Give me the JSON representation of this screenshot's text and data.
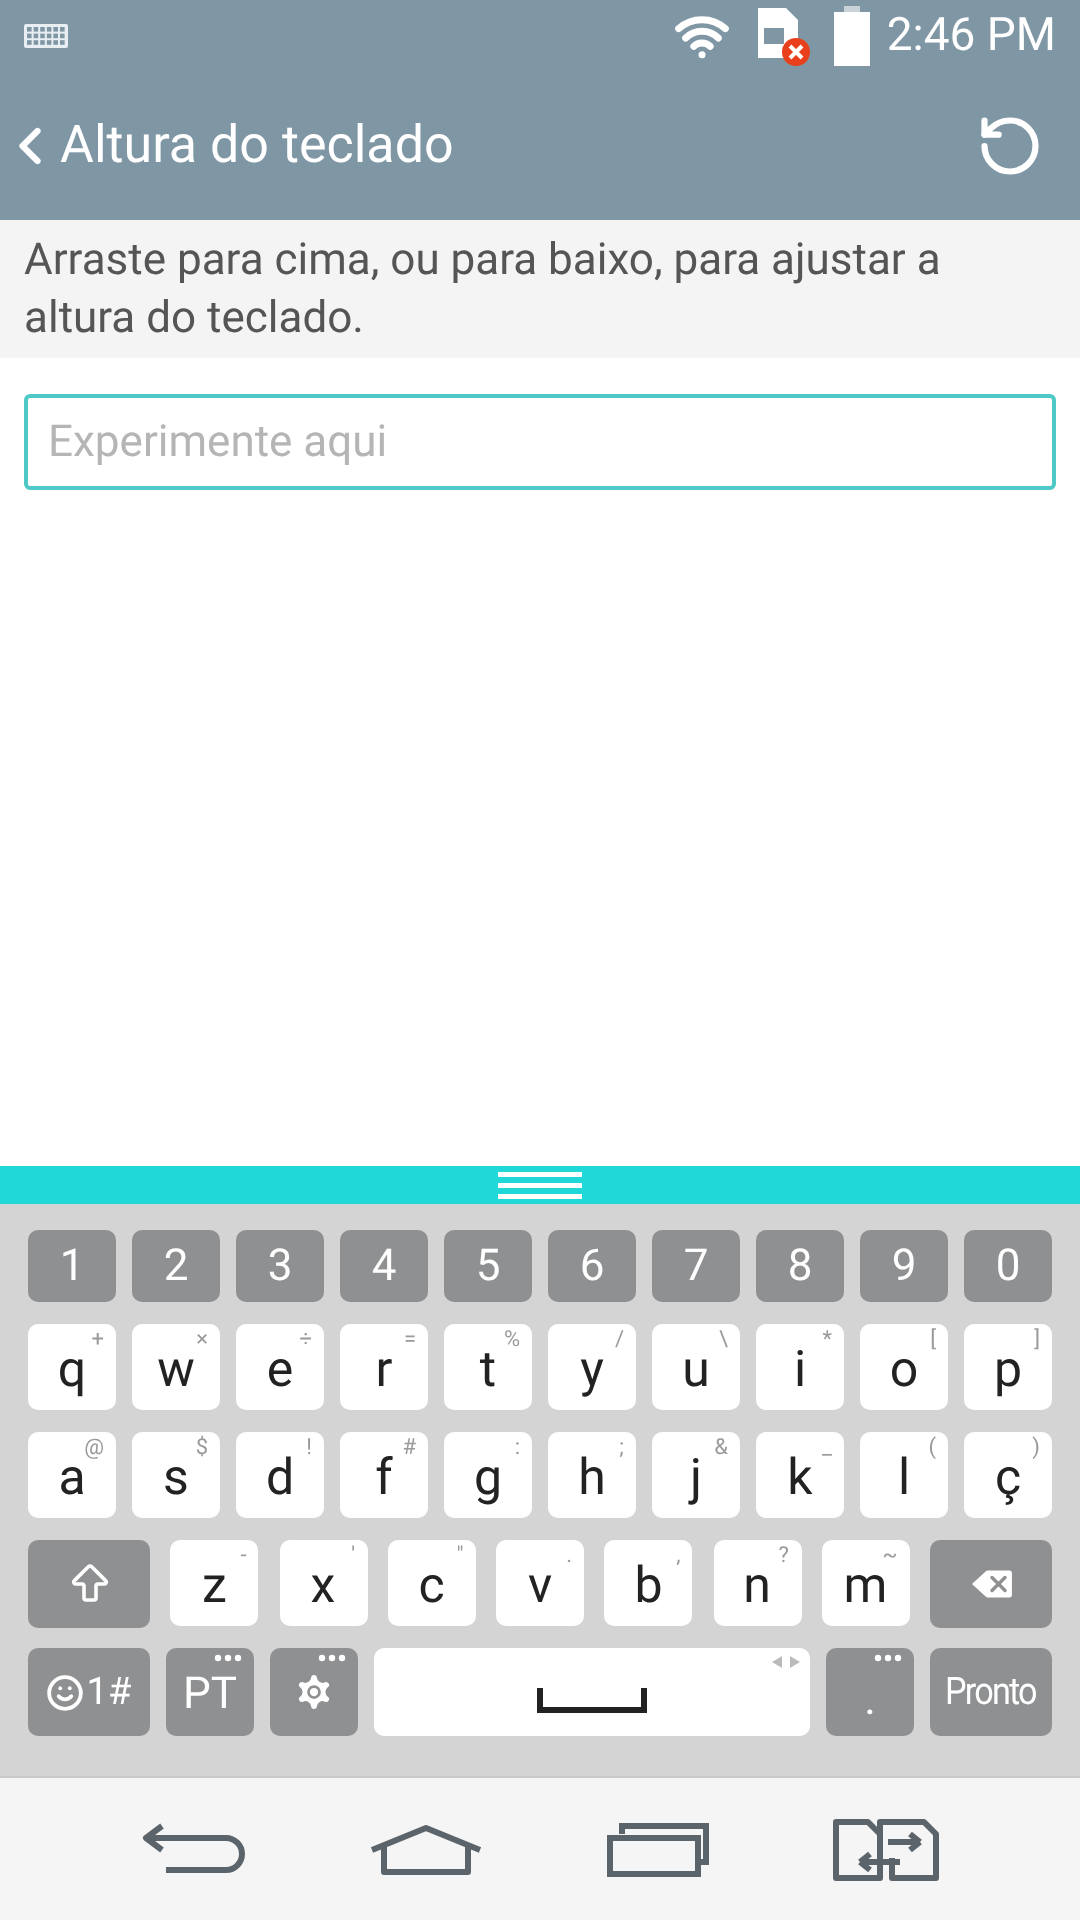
{
  "status_bar": {
    "time": "2:46 PM"
  },
  "app_bar": {
    "title": "Altura do teclado"
  },
  "description": "Arraste para cima, ou para baixo, para ajustar a altura do teclado.",
  "input": {
    "placeholder": "Experimente aqui"
  },
  "keyboard": {
    "number_row": [
      "1",
      "2",
      "3",
      "4",
      "5",
      "6",
      "7",
      "8",
      "9",
      "0"
    ],
    "letter_rows": [
      [
        {
          "main": "q",
          "hint": "+"
        },
        {
          "main": "w",
          "hint": "×"
        },
        {
          "main": "e",
          "hint": "÷"
        },
        {
          "main": "r",
          "hint": "="
        },
        {
          "main": "t",
          "hint": "%"
        },
        {
          "main": "y",
          "hint": "/"
        },
        {
          "main": "u",
          "hint": "\\"
        },
        {
          "main": "i",
          "hint": "*"
        },
        {
          "main": "o",
          "hint": "["
        },
        {
          "main": "p",
          "hint": "]"
        }
      ],
      [
        {
          "main": "a",
          "hint": "@"
        },
        {
          "main": "s",
          "hint": "$"
        },
        {
          "main": "d",
          "hint": "!"
        },
        {
          "main": "f",
          "hint": "#"
        },
        {
          "main": "g",
          "hint": ":"
        },
        {
          "main": "h",
          "hint": ";"
        },
        {
          "main": "j",
          "hint": "&"
        },
        {
          "main": "k",
          "hint": "_"
        },
        {
          "main": "l",
          "hint": "("
        },
        {
          "main": "ç",
          "hint": ")"
        }
      ]
    ],
    "third_row": [
      {
        "kind": "shift"
      },
      {
        "kind": "letter",
        "main": "z",
        "hint": "-"
      },
      {
        "kind": "letter",
        "main": "x",
        "hint": "'"
      },
      {
        "kind": "letter",
        "main": "c",
        "hint": "\""
      },
      {
        "kind": "letter",
        "main": "v",
        "hint": "."
      },
      {
        "kind": "letter",
        "main": "b",
        "hint": ","
      },
      {
        "kind": "letter",
        "main": "n",
        "hint": "?"
      },
      {
        "kind": "letter",
        "main": "m",
        "hint": "~"
      },
      {
        "kind": "backspace"
      }
    ],
    "bottom_row": [
      {
        "kind": "symbols",
        "label": "1#",
        "more": false
      },
      {
        "kind": "language",
        "label": "PT",
        "more": true
      },
      {
        "kind": "settings",
        "more": true
      },
      {
        "kind": "space",
        "more": false
      },
      {
        "kind": "period",
        "label": ".",
        "more": true
      },
      {
        "kind": "done",
        "label": "Pronto",
        "more": false
      }
    ]
  }
}
